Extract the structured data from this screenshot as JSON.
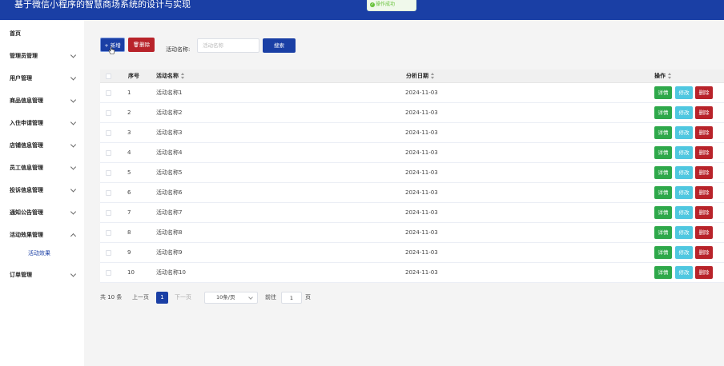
{
  "header": {
    "title": "基于微信小程序的智慧商场系统的设计与实现"
  },
  "toast": {
    "message": "操作成功",
    "icon": "check-circle-icon"
  },
  "sidebar": {
    "items": [
      {
        "label": "首页",
        "expandable": false
      },
      {
        "label": "管理员管理",
        "expandable": true
      },
      {
        "label": "用户管理",
        "expandable": true
      },
      {
        "label": "商品信息管理",
        "expandable": true
      },
      {
        "label": "入住申请管理",
        "expandable": true
      },
      {
        "label": "店铺信息管理",
        "expandable": true
      },
      {
        "label": "员工信息管理",
        "expandable": true
      },
      {
        "label": "投诉信息管理",
        "expandable": true
      },
      {
        "label": "通知公告管理",
        "expandable": true
      },
      {
        "label": "活动效果管理",
        "expandable": true,
        "expanded": true
      },
      {
        "label": "订单管理",
        "expandable": true
      }
    ],
    "submenu": {
      "label": "活动效果"
    }
  },
  "toolbar": {
    "add_label": "+ 新增",
    "delete_label": "🗑删除",
    "search_label": "活动名称:",
    "search_placeholder": "活动名称",
    "search_value": "",
    "search_button": "搜索"
  },
  "table": {
    "columns": {
      "index": "序号",
      "name": "活动名称",
      "date": "分析日期",
      "actions": "操作"
    },
    "rows": [
      {
        "index": "1",
        "name": "活动名称1",
        "date": "2024-11-03"
      },
      {
        "index": "2",
        "name": "活动名称2",
        "date": "2024-11-03"
      },
      {
        "index": "3",
        "name": "活动名称3",
        "date": "2024-11-03"
      },
      {
        "index": "4",
        "name": "活动名称4",
        "date": "2024-11-03"
      },
      {
        "index": "5",
        "name": "活动名称5",
        "date": "2024-11-03"
      },
      {
        "index": "6",
        "name": "活动名称6",
        "date": "2024-11-03"
      },
      {
        "index": "7",
        "name": "活动名称7",
        "date": "2024-11-03"
      },
      {
        "index": "8",
        "name": "活动名称8",
        "date": "2024-11-03"
      },
      {
        "index": "9",
        "name": "活动名称9",
        "date": "2024-11-03"
      },
      {
        "index": "10",
        "name": "活动名称10",
        "date": "2024-11-03"
      }
    ],
    "actions": {
      "detail": "详情",
      "edit": "修改",
      "delete": "删除"
    }
  },
  "pagination": {
    "total": "共 10 条",
    "prev": "上一页",
    "current": "1",
    "next": "下一页",
    "page_size": "10条/页",
    "goto_label": "前往",
    "goto_value": "1",
    "page_suffix": "页"
  },
  "colors": {
    "primary": "#1a3fa5",
    "danger": "#b8232a",
    "success": "#2ea84a",
    "info": "#4fc7e0"
  }
}
